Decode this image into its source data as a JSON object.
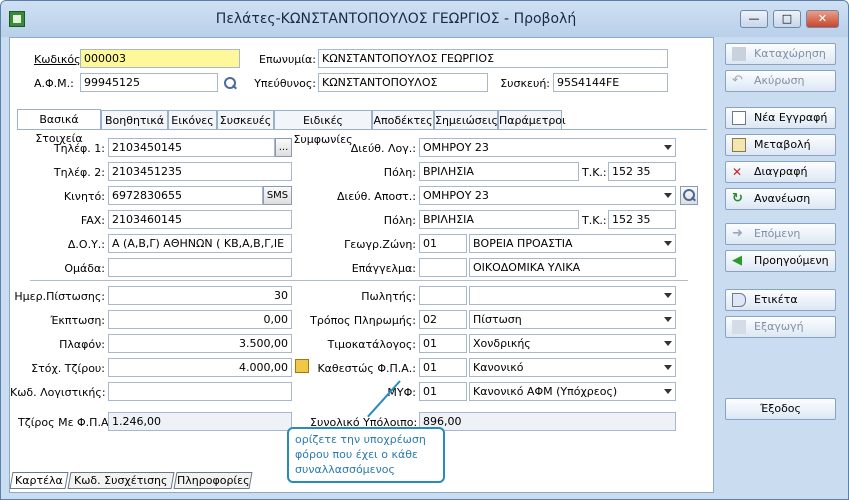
{
  "window": {
    "title": "Πελάτες-ΚΩΝΣΤΑΝΤΟΠΟΥΛΟΣ ΓΕΩΡΓΙΟΣ -  Προβολή",
    "min_label": "—",
    "max_label": "□",
    "close_label": "✕"
  },
  "header": {
    "code_label": "Κωδικός:",
    "code_value": "000003",
    "name_label": "Επωνυμία:",
    "name_value": "ΚΩΝΣΤΑΝΤΟΠΟΥΛΟΣ ΓΕΩΡΓΙΟΣ",
    "afm_label": "Α.Φ.Μ.:",
    "afm_value": "99945125",
    "resp_label": "Υπεύθυνος:",
    "resp_value": "ΚΩΝΣΤΑΝΤΟΠΟΥΛΟΣ",
    "device_label": "Συσκευή:",
    "device_value": "95S4144FE"
  },
  "tabs": [
    "Βασικά Στοιχεία",
    "Βοηθητικά",
    "Εικόνες",
    "Συσκευές",
    "Ειδικές Συμφωνίες",
    "Αποδέκτες",
    "Σημειώσεις",
    "Παράμετροι"
  ],
  "left": {
    "tel1_label": "Τηλέφ. 1:",
    "tel1_value": "2103450145",
    "more_label": "...",
    "tel2_label": "Τηλέφ. 2:",
    "tel2_value": "2103451235",
    "mobile_label": "Κινητό:",
    "mobile_value": "6972830655",
    "sms_label": "SMS",
    "fax_label": "FAX:",
    "fax_value": "2103460145",
    "doy_label": "Δ.Ο.Υ.:",
    "doy_value": "Α (Α,Β,Γ) ΑΘΗΝΩΝ ( ΚΒ,Α,Β,Γ,ΙΕ",
    "group_label": "Ομάδα:",
    "group_value": "",
    "credit_days_label": "Ημερ.Πίστωσης:",
    "credit_days_value": "30",
    "discount_label": "Έκπτωση:",
    "discount_value": "0,00",
    "plafond_label": "Πλαφόν:",
    "plafond_value": "3.500,00",
    "target_label": "Στόχ. Τζίρου:",
    "target_value": "4.000,00",
    "accounting_label": "Κωδ. Λογιστικής:",
    "accounting_value": ""
  },
  "right": {
    "addr_label": "Διεύθ. Λογ.:",
    "addr_value": "ΟΜΗΡΟΥ 23",
    "city_label": "Πόλη:",
    "city_value": "ΒΡΙΛΗΣΙΑ",
    "zip_label": "Τ.Κ.:",
    "zip_value": "152 35",
    "ship_label": "Διεύθ. Αποστ.:",
    "ship_value": "ΟΜΗΡΟΥ 23",
    "city2_label": "Πόλη:",
    "city2_value": "ΒΡΙΛΗΣΙΑ",
    "zip2_label": "Τ.Κ.:",
    "zip2_value": "152 35",
    "zone_label": "Γεωγρ.Ζώνη:",
    "zone_code": "01",
    "zone_value": "ΒΟΡΕΙΑ ΠΡΟΑΣΤΙΑ",
    "job_label": "Επάγγελμα:",
    "job_code": "",
    "job_value": "ΟΙΚΟΔΟΜΙΚΑ ΥΛΙΚΑ",
    "seller_label": "Πωλητής:",
    "seller_code": "",
    "seller_value": "",
    "payment_label": "Τρόπος Πληρωμής:",
    "payment_code": "02",
    "payment_value": "Πίστωση",
    "pricelist_label": "Τιμοκατάλογος:",
    "pricelist_code": "01",
    "pricelist_value": "Χονδρικής",
    "vat_label": "Καθεστώς Φ.Π.Α.:",
    "vat_code": "01",
    "vat_value": "Κανονικό",
    "myf_label": "ΜΥΦ:",
    "myf_code": "01",
    "myf_value": "Κανονικό ΑΦΜ (Υπόχρεος)"
  },
  "totals": {
    "turnover_label": "Τζίρος Με Φ.Π.Α.:",
    "turnover_value": "1.246,00",
    "balance_label": "Συνολικό Υπόλοιπο:",
    "balance_value": "896,00"
  },
  "callout": "ορίζετε την υποχρέωση φόρου που έχει ο κάθε συναλλασσόμενος",
  "bottom_tabs": [
    "Καρτέλα",
    "Κωδ. Συσχέτισης",
    "Πληροφορίες"
  ],
  "actions": {
    "save": "Καταχώρηση",
    "cancel": "Ακύρωση",
    "new": "Νέα Εγγραφή",
    "edit": "Μεταβολή",
    "delete": "Διαγραφή",
    "refresh": "Ανανέωση",
    "next": "Επόμενη",
    "prev": "Προηγούμενη",
    "label": "Ετικέτα",
    "export": "Εξαγωγή",
    "exit": "Έξοδος"
  }
}
